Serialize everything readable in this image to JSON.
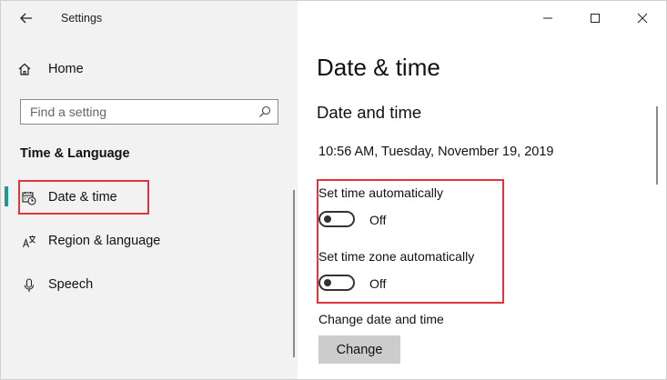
{
  "window": {
    "title": "Settings"
  },
  "sidebar": {
    "home_label": "Home",
    "search_placeholder": "Find a setting",
    "section_heading": "Time & Language",
    "items": [
      {
        "label": "Date & time",
        "icon": "calendar-clock-icon",
        "selected": true
      },
      {
        "label": "Region & language",
        "icon": "language-icon",
        "selected": false
      },
      {
        "label": "Speech",
        "icon": "microphone-icon",
        "selected": false
      }
    ]
  },
  "main": {
    "page_title": "Date & time",
    "section_title": "Date and time",
    "current_datetime": "10:56 AM, Tuesday, November 19, 2019",
    "set_time_auto": {
      "label": "Set time automatically",
      "state": "Off"
    },
    "set_timezone_auto": {
      "label": "Set time zone automatically",
      "state": "Off"
    },
    "change_section_label": "Change date and time",
    "change_button": "Change"
  },
  "colors": {
    "accent": "#1a9b8f",
    "highlight_box": "#e0353c",
    "sidebar_bg": "#f2f2f2",
    "button_bg": "#cccccc"
  }
}
